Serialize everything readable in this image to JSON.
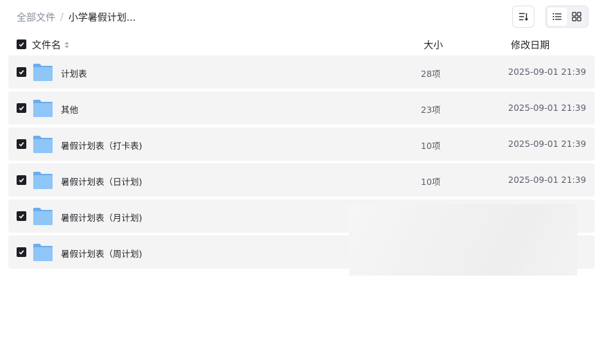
{
  "breadcrumb": {
    "root": "全部文件",
    "separator": "/",
    "current": "小学暑假计划..."
  },
  "toolbar": {
    "sort_icon": "sort-lines-icon",
    "list_view_icon": "list-view-icon",
    "grid_view_icon": "grid-view-icon"
  },
  "table": {
    "headers": {
      "name": "文件名",
      "size": "大小",
      "date": "修改日期"
    },
    "rows": [
      {
        "name": "计划表",
        "size": "28项",
        "date": "2025-09-01 21:39",
        "checked": true
      },
      {
        "name": "其他",
        "size": "23项",
        "date": "2025-09-01 21:39",
        "checked": true
      },
      {
        "name": "暑假计划表（打卡表)",
        "size": "10项",
        "date": "2025-09-01 21:39",
        "checked": true
      },
      {
        "name": "暑假计划表（日计划)",
        "size": "10项",
        "date": "2025-09-01 21:39",
        "checked": true
      },
      {
        "name": "暑假计划表（月计划)",
        "size": "",
        "date": "",
        "checked": true
      },
      {
        "name": "暑假计划表（周计划)",
        "size": "",
        "date": "",
        "checked": true
      }
    ]
  },
  "colors": {
    "row_bg": "#f4f4f5",
    "checkbox": "#1d1f24",
    "folder_body": "#8ec6f7",
    "folder_tab": "#6aaef0",
    "muted_text": "#878c9c"
  }
}
